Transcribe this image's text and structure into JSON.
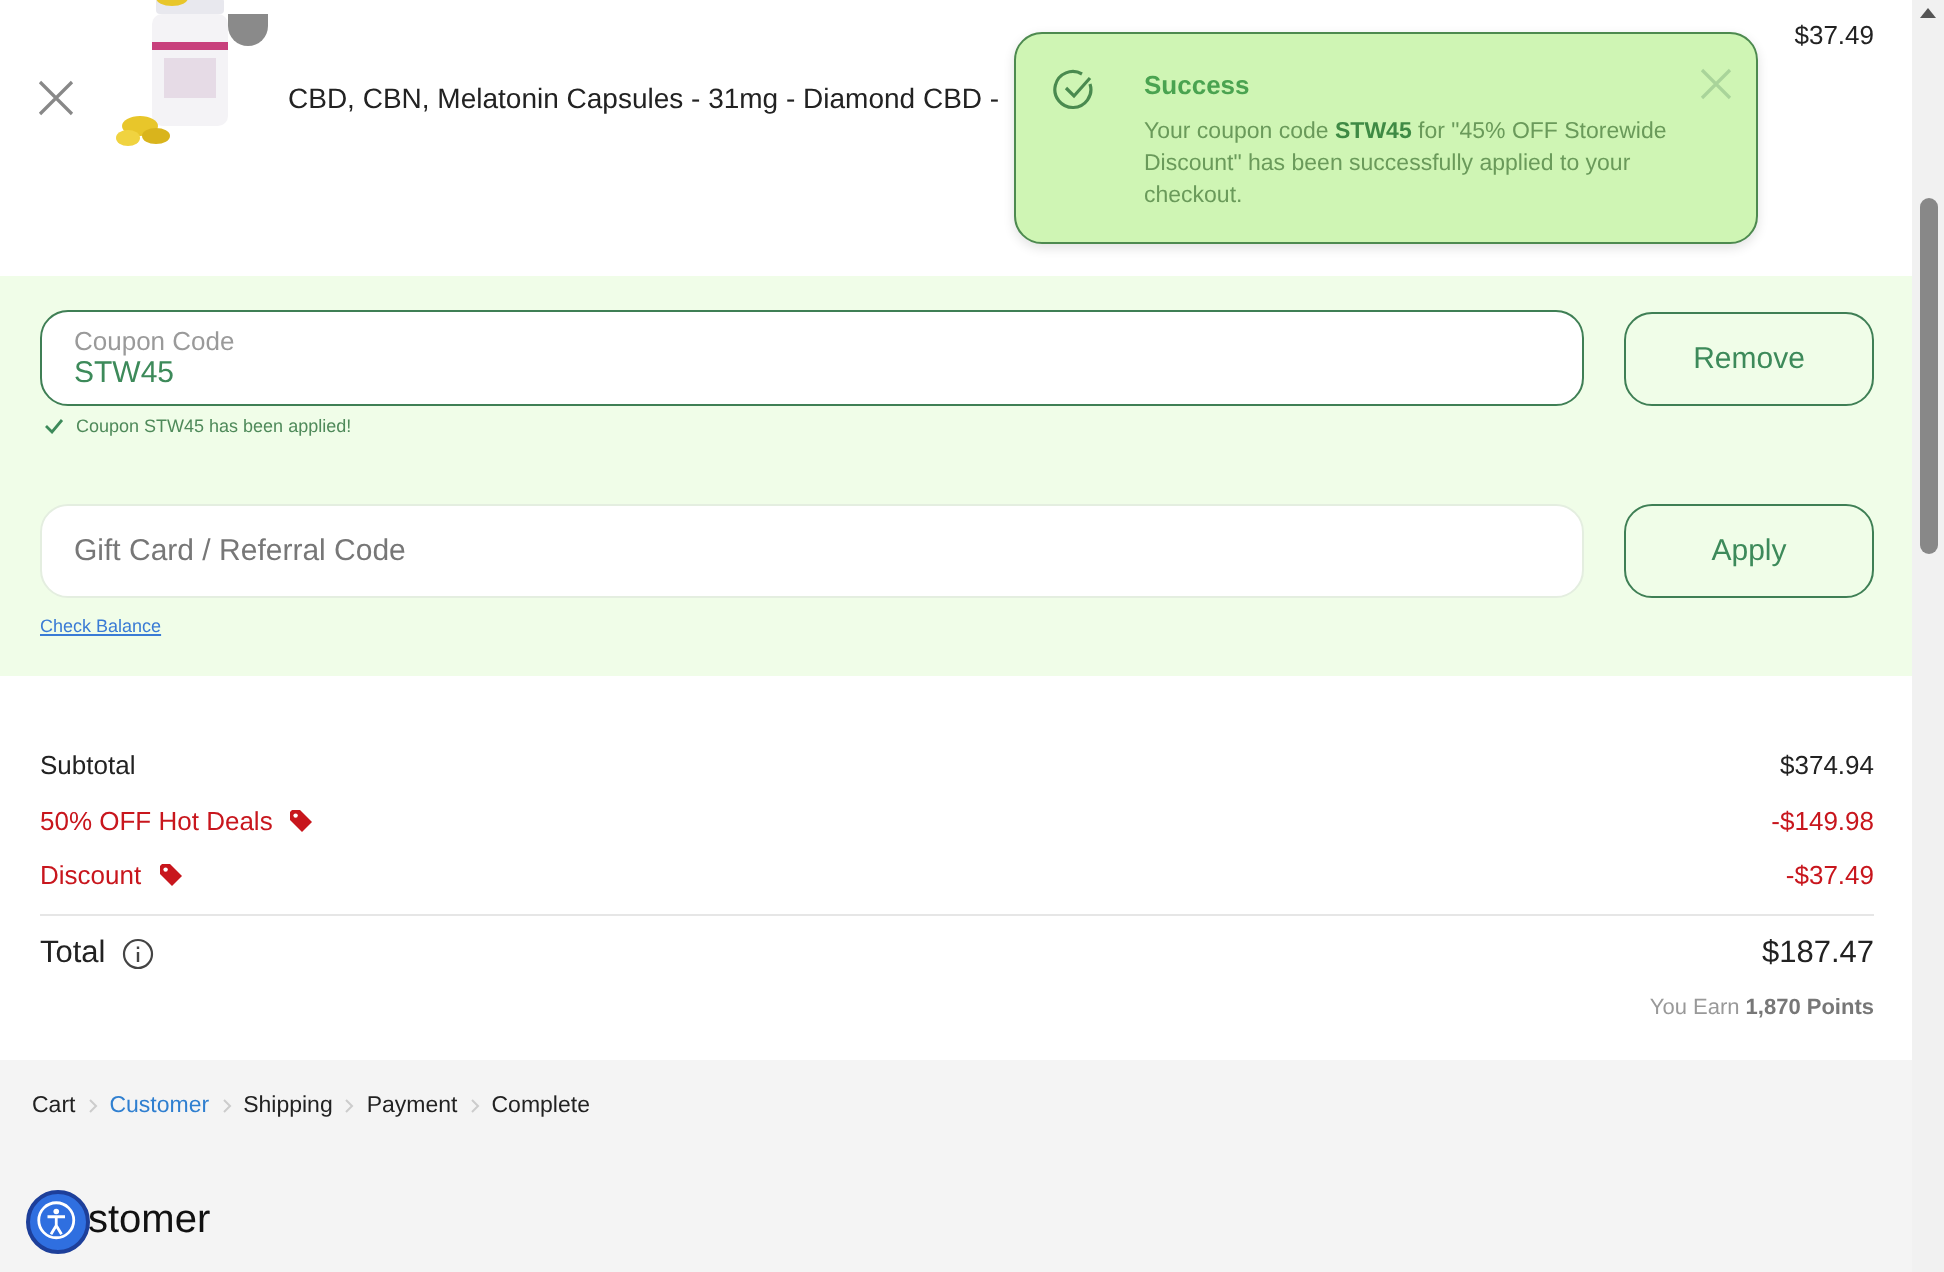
{
  "cart_item": {
    "product_name": "CBD, CBN, Melatonin Capsules - 31mg - Diamond CBD -",
    "price": "$37.49"
  },
  "toast": {
    "title": "Success",
    "message": "Your coupon code **STW45** for \"45% OFF Storewide Discount\" has been successfully applied to your checkout."
  },
  "coupon": {
    "label": "Coupon Code",
    "value": "STW45",
    "button": "Remove",
    "applied_note": "Coupon STW45 has been applied!"
  },
  "gift_card": {
    "placeholder": "Gift Card / Referral Code",
    "button": "Apply",
    "link": "Check Balance"
  },
  "summary": {
    "rows": [
      {
        "label": "Subtotal",
        "value": "$374.94",
        "kind": "plain"
      },
      {
        "label": "50% OFF Hot Deals",
        "value": "-$149.98",
        "kind": "discount"
      },
      {
        "label": "Discount",
        "value": "-$37.49",
        "kind": "discount"
      }
    ],
    "total": {
      "label": "Total",
      "value": "$187.47"
    },
    "points_label": "You Earn",
    "points": "1,870 Points"
  },
  "breadcrumb": [
    {
      "label": "Cart",
      "selected": false
    },
    {
      "label": "Customer",
      "selected": true
    },
    {
      "label": "Shipping",
      "selected": false
    },
    {
      "label": "Payment",
      "selected": false
    },
    {
      "label": "Complete",
      "selected": false
    }
  ],
  "heading": "stomer"
}
